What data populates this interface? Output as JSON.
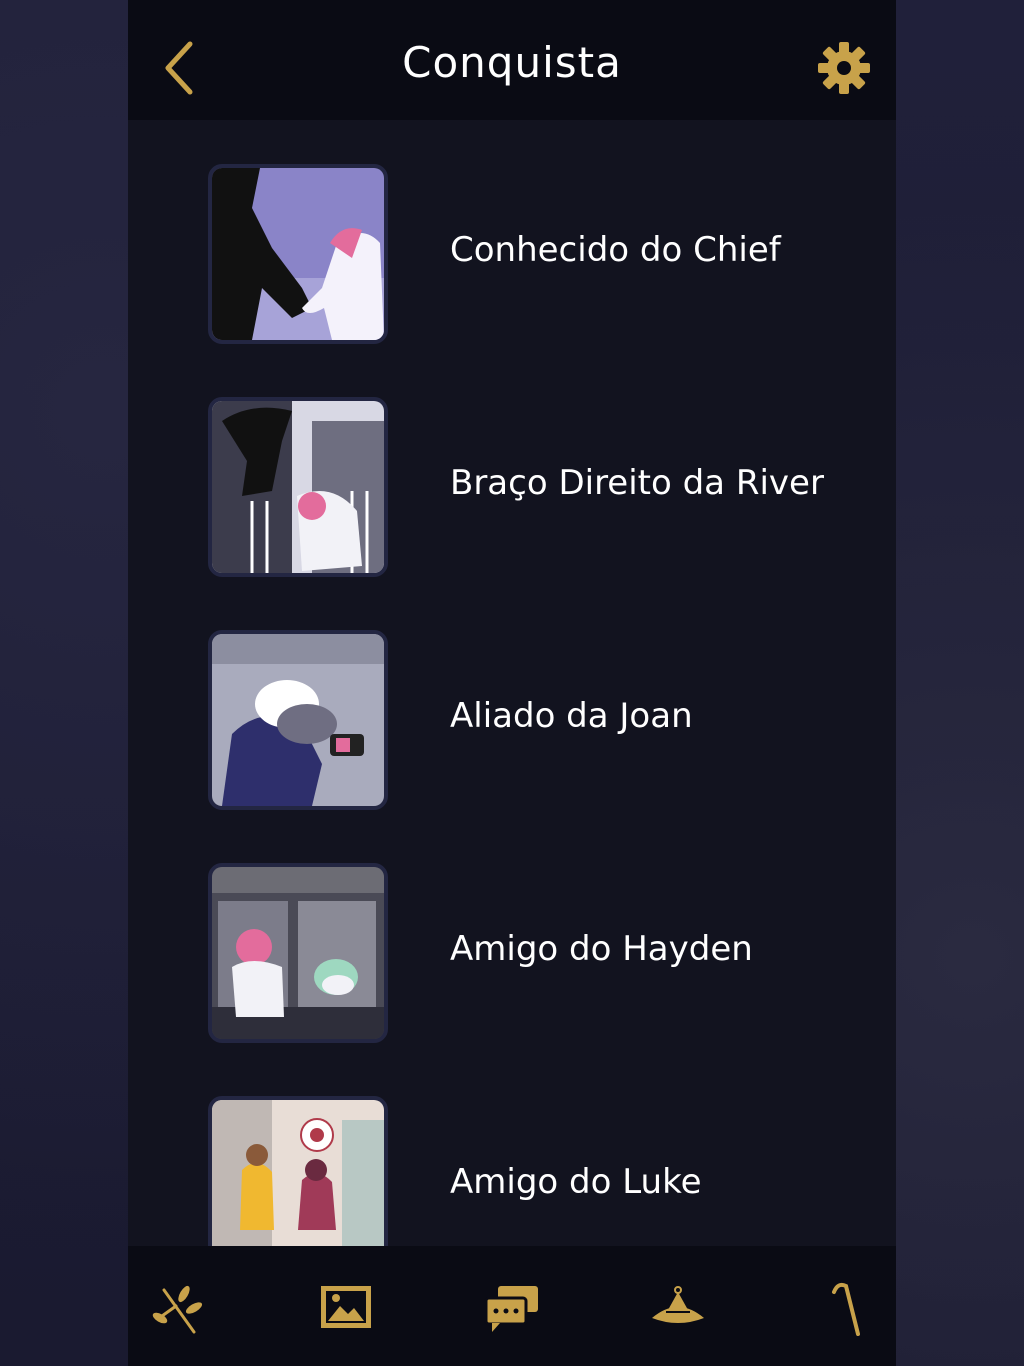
{
  "header": {
    "title": "Conquista",
    "back_icon": "chevron-left-icon",
    "settings_icon": "gear-icon"
  },
  "achievements": [
    {
      "label": "Conhecido do Chief",
      "thumbnail": "chief-handshake-illustration"
    },
    {
      "label": "Braço Direito da River",
      "thumbnail": "river-rooftop-illustration"
    },
    {
      "label": "Aliado da Joan",
      "thumbnail": "joan-camera-illustration"
    },
    {
      "label": "Amigo do Hayden",
      "thumbnail": "hayden-window-illustration"
    },
    {
      "label": "Amigo do Luke",
      "thumbnail": "luke-street-illustration"
    }
  ],
  "navbar": {
    "items": [
      {
        "icon": "branch-icon"
      },
      {
        "icon": "gallery-icon"
      },
      {
        "icon": "chat-icon"
      },
      {
        "icon": "hat-icon"
      },
      {
        "icon": "cane-icon"
      }
    ]
  },
  "colors": {
    "accent_gold": "#c8a24a",
    "header_bg": "#0a0b14",
    "panel_bg": "#12131f",
    "text": "#ffffff"
  }
}
